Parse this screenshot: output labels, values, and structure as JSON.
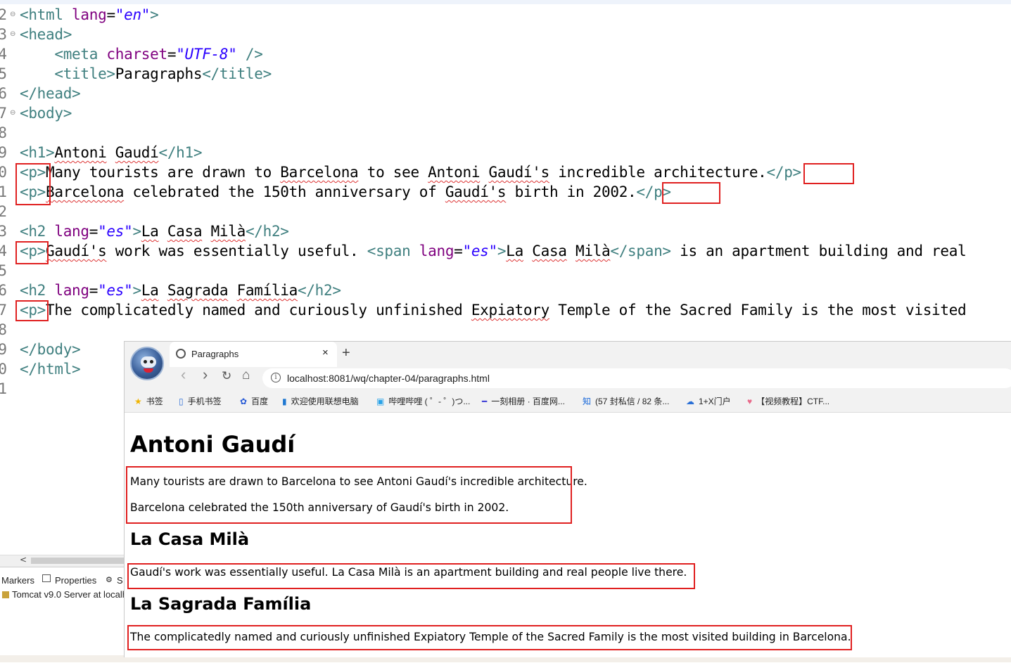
{
  "editor": {
    "lines": [
      {
        "num": "2",
        "fold": true
      },
      {
        "num": "3",
        "fold": true
      },
      {
        "num": "4",
        "fold": false
      },
      {
        "num": "5",
        "fold": false
      },
      {
        "num": "6",
        "fold": false
      },
      {
        "num": "7",
        "fold": true
      },
      {
        "num": "8",
        "fold": false
      },
      {
        "num": "9",
        "fold": false
      },
      {
        "num": "0",
        "fold": false
      },
      {
        "num": "1",
        "fold": false
      },
      {
        "num": "2",
        "fold": false
      },
      {
        "num": "3",
        "fold": false
      },
      {
        "num": "4",
        "fold": false
      },
      {
        "num": "5",
        "fold": false
      },
      {
        "num": "6",
        "fold": false
      },
      {
        "num": "7",
        "fold": false
      },
      {
        "num": "8",
        "fold": false
      },
      {
        "num": "9",
        "fold": false
      },
      {
        "num": "0",
        "fold": false
      },
      {
        "num": "1",
        "fold": false
      }
    ],
    "code": {
      "l2_tag": "<html",
      "l2_attr": " lang",
      "l2_eq": "=",
      "l2_val": "\"en\"",
      "l2_close": ">",
      "l3_tag": "<head>",
      "l4_tag": "<meta",
      "l4_attr": " charset",
      "l4_eq": "=",
      "l4_val": "\"UTF-8\"",
      "l4_close": " />",
      "l5_open": "<title>",
      "l5_text": "Paragraphs",
      "l5_close": "</title>",
      "l6_tag": "</head>",
      "l7_tag": "<body>",
      "l9_open": "<h1>",
      "l9_w1": "Antoni",
      "l9_sp": " ",
      "l9_w2": "Gaudí",
      "l9_close": "</h1>",
      "l10_open": "<p>",
      "l10_a": "Many tourists are drawn to ",
      "l10_w1": "Barcelona",
      "l10_b": " to see ",
      "l10_w2": "Antoni",
      "l10_sp": " ",
      "l10_w3": "Gaudí's",
      "l10_c": " incredible architecture.",
      "l10_close": "</p>",
      "l11_open": "<p>",
      "l11_w1": "Barcelona",
      "l11_a": " celebrated the 150th anniversary of ",
      "l11_w2": "Gaudí's",
      "l11_b": " birth in 2002.",
      "l11_close": "</p>",
      "l13_tag": "<h2",
      "l13_attr": " lang",
      "l13_eq": "=",
      "l13_val": "\"es\"",
      "l13_gt": ">",
      "l13_w1": "La",
      "l13_sp1": " ",
      "l13_w2": "Casa",
      "l13_sp2": " ",
      "l13_w3": "Milà",
      "l13_close": "</h2>",
      "l14_open": "<p>",
      "l14_w1": "Gaudí's",
      "l14_a": " work was essentially useful. ",
      "l14_span": "<span",
      "l14_attr": " lang",
      "l14_eq": "=",
      "l14_val": "\"es\"",
      "l14_gt": ">",
      "l14_w2": "La",
      "l14_sp1": " ",
      "l14_w3": "Casa",
      "l14_sp2": " ",
      "l14_w4": "Milà",
      "l14_spanclose": "</span>",
      "l14_b": " is an apartment building and real",
      "l16_tag": "<h2",
      "l16_attr": " lang",
      "l16_eq": "=",
      "l16_val": "\"es\"",
      "l16_gt": ">",
      "l16_w1": "La",
      "l16_sp1": " ",
      "l16_w2": "Sagrada",
      "l16_sp2": " ",
      "l16_w3": "Família",
      "l16_close": "</h2>",
      "l17_open": "<p>",
      "l17_a": "The complicatedly named and curiously unfinished ",
      "l17_w1": "Expiatory",
      "l17_b": " Temple of the Sacred Family is the most visited",
      "l19_tag": "</body>",
      "l20_tag": "</html>"
    }
  },
  "panel": {
    "scroll_arrow": "<",
    "tabs": [
      "Markers",
      "Properties",
      "S"
    ],
    "server_line": "Tomcat v9.0 Server at localh"
  },
  "browser": {
    "tab_title": "Paragraphs",
    "tab_close": "×",
    "new_tab": "+",
    "back": "‹",
    "forward": "›",
    "reload": "↻",
    "home": "⌂",
    "url": "localhost:8081/wq/chapter-04/paragraphs.html",
    "bookmarks": [
      {
        "icon": "★",
        "color": "#f0b400",
        "label": "书签"
      },
      {
        "icon": "▯",
        "color": "#2f6fd6",
        "label": "手机书签"
      },
      {
        "icon": "✿",
        "color": "#2458d6",
        "label": "百度"
      },
      {
        "icon": "▮",
        "color": "#1f78d1",
        "label": "欢迎使用联想电脑"
      },
      {
        "icon": "▣",
        "color": "#2aa3e8",
        "label": "哔哩哔哩 ( ゜- ゜)つ..."
      },
      {
        "icon": "━",
        "color": "#3b3bd6",
        "label": "一刻相册 · 百度网..."
      },
      {
        "icon": "知",
        "color": "#1667d9",
        "label": "(57 封私信 / 82 条..."
      },
      {
        "icon": "☁",
        "color": "#2a6fd6",
        "label": "1+X门户"
      },
      {
        "icon": "♥",
        "color": "#e86a8a",
        "label": "【视频教程】CTF..."
      }
    ],
    "page": {
      "h1": "Antoni Gaudí",
      "p1": "Many tourists are drawn to Barcelona to see Antoni Gaudí's incredible architecture.",
      "p2": "Barcelona celebrated the 150th anniversary of Gaudí's birth in 2002.",
      "h2_1": "La Casa Milà",
      "p3": "Gaudí's work was essentially useful. La Casa Milà is an apartment building and real people live there.",
      "h2_2": "La Sagrada Família",
      "p4": "The complicatedly named and curiously unfinished Expiatory Temple of the Sacred Family is the most visited building in Barcelona."
    }
  },
  "colors": {
    "tag": "#3f7f7f",
    "attribute": "#7f007f",
    "value": "#2a00ff",
    "highlight_box": "#e02020"
  }
}
